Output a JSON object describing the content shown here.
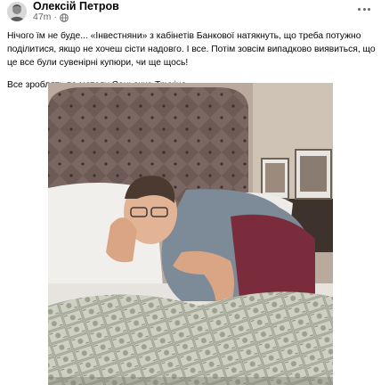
{
  "post": {
    "author": "Олексій Петров",
    "time": "47m",
    "paragraph1": "Нічого їм не буде... «Інвестняни» з кабінетів Банкової натякнуть, що треба потужно поділитися, якщо не хочеш сісти надовго. І все. Потім зовсім випадково виявиться, що це все були сувенірні купюри, чи ще щось!",
    "paragraph2": "Все зроблять по методу Саньочка Трухіна."
  },
  "icons": {
    "audience": "globe-icon",
    "menu": "more-options-icon"
  },
  "colors": {
    "text": "#050505",
    "secondary_text": "#65676b",
    "background": "#ffffff"
  }
}
